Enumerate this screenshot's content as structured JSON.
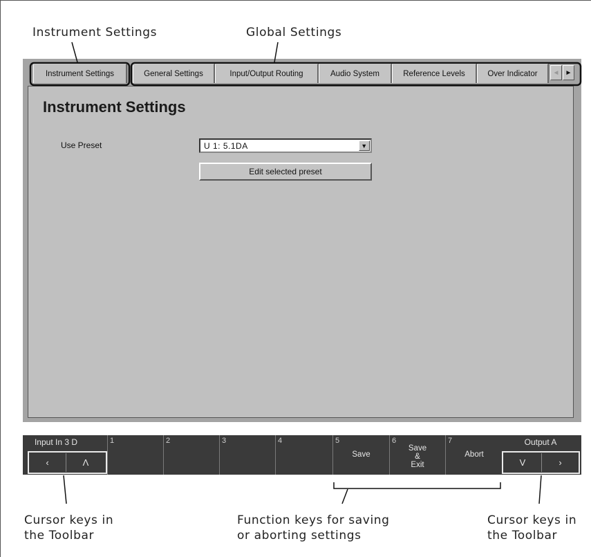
{
  "annotations": {
    "instrument_settings": "Instrument Settings",
    "global_settings": "Global Settings",
    "cursor_keys_left_line1": "Cursor keys in",
    "cursor_keys_left_line2": "the Toolbar",
    "function_keys_line1": "Function keys for saving",
    "function_keys_line2": "or aborting settings",
    "cursor_keys_right_line1": "Cursor keys in",
    "cursor_keys_right_line2": "the Toolbar"
  },
  "tabs": [
    {
      "label": "Instrument Settings",
      "active": true
    },
    {
      "label": "General Settings"
    },
    {
      "label": "Input/Output Routing"
    },
    {
      "label": "Audio System"
    },
    {
      "label": "Reference Levels"
    },
    {
      "label": "Over Indicator"
    }
  ],
  "tab_scroll": {
    "left_icon": "◄",
    "right_icon": "►"
  },
  "page": {
    "title": "Instrument Settings",
    "use_preset_label": "Use Preset",
    "preset_value": "U 1: 5.1DA",
    "dropdown_icon": "▼",
    "edit_button": "Edit selected preset"
  },
  "toolbar": {
    "left_title": "Input In 3 D",
    "left_keys": [
      "‹",
      "Λ"
    ],
    "right_title": "Output A",
    "right_keys": [
      "V",
      "›"
    ],
    "function_keys": [
      {
        "num": "1",
        "label": ""
      },
      {
        "num": "2",
        "label": ""
      },
      {
        "num": "3",
        "label": ""
      },
      {
        "num": "4",
        "label": ""
      },
      {
        "num": "5",
        "label": "Save"
      },
      {
        "num": "6",
        "label": "Save\n&\nExit"
      },
      {
        "num": "7",
        "label": "Abort"
      }
    ]
  },
  "colors": {
    "screen_bg": "#a4a4a4",
    "panel_bg": "#c0c0c0",
    "toolbar_bg": "#3a3a3a",
    "toolbar_text": "#e6e6e6"
  }
}
